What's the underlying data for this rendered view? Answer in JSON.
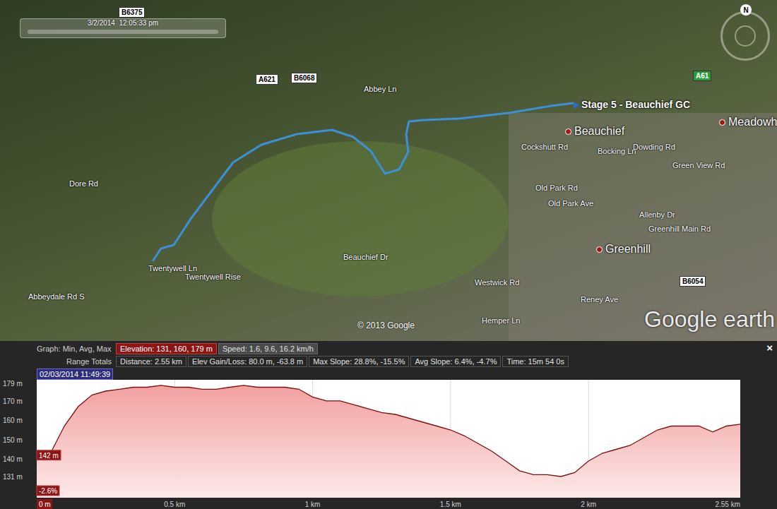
{
  "map": {
    "timestamp": "3/2/2014  12:05:33 pm",
    "compass": "N",
    "copyright": "© 2013 Google",
    "logo": "Google earth",
    "labels": [
      {
        "text": "B6375",
        "kind": "shield",
        "color": "#ffffff"
      },
      {
        "text": "A621",
        "kind": "shield",
        "color": "#ffffff"
      },
      {
        "text": "B6068",
        "kind": "shield",
        "color": "#ffffff"
      },
      {
        "text": "A61",
        "kind": "shield",
        "color": "#2e9b3a"
      },
      {
        "text": "B6054",
        "kind": "shield",
        "color": "#ffffff"
      },
      {
        "text": "Abbey Ln",
        "kind": "road"
      },
      {
        "text": "Dore Rd",
        "kind": "road"
      },
      {
        "text": "Abbeydale Rd S",
        "kind": "road"
      },
      {
        "text": "Twentywell Ln",
        "kind": "road"
      },
      {
        "text": "Twentywell Rise",
        "kind": "road"
      },
      {
        "text": "Beauchief Dr",
        "kind": "road"
      },
      {
        "text": "Cockshutt Rd",
        "kind": "road"
      },
      {
        "text": "Old Park Rd",
        "kind": "road"
      },
      {
        "text": "Old Park Ave",
        "kind": "road"
      },
      {
        "text": "Bocking Ln",
        "kind": "road"
      },
      {
        "text": "Dowding Rd",
        "kind": "road"
      },
      {
        "text": "Green View Rd",
        "kind": "road"
      },
      {
        "text": "Allenby Dr",
        "kind": "road"
      },
      {
        "text": "Greenhill Main Rd",
        "kind": "road"
      },
      {
        "text": "Westwick Rd",
        "kind": "road"
      },
      {
        "text": "Hemper Ln",
        "kind": "road"
      },
      {
        "text": "Reney Ave",
        "kind": "road"
      },
      {
        "text": "Beauchief",
        "kind": "place"
      },
      {
        "text": "Greenhill",
        "kind": "place"
      },
      {
        "text": "Meadowh",
        "kind": "place"
      },
      {
        "text": "Stage 5 - Beauchief GC",
        "kind": "track"
      }
    ]
  },
  "graph": {
    "title": "Graph: Min, Avg, Max",
    "close": "×",
    "stats": [
      {
        "text": "Elevation: 131, 160, 179 m",
        "selected": true
      },
      {
        "text": "Speed: 1.6, 9.6, 16.2 km/h",
        "selected": false
      }
    ],
    "totals_label": "Range Totals",
    "totals": [
      "Distance: 2.55 km",
      "Elev Gain/Loss: 80.0 m, -63.8 m",
      "Max Slope: 28.8%, -15.5%",
      "Avg Slope: 6.4%, -4.7%",
      "Time: 15m 54 0s"
    ],
    "date": "02/03/2014 11:49:39",
    "y_ticks": [
      {
        "text": "179 m",
        "value": 179
      },
      {
        "text": "170 m",
        "value": 170
      },
      {
        "text": "160 m",
        "value": 160
      },
      {
        "text": "150 m",
        "value": 150
      },
      {
        "text": "140 m",
        "value": 140
      },
      {
        "text": "131 m",
        "value": 131
      }
    ],
    "x_ticks": [
      {
        "text": "0 m",
        "km": 0
      },
      {
        "text": "0.5 km",
        "km": 0.5
      },
      {
        "text": "1 km",
        "km": 1
      },
      {
        "text": "1.5 km",
        "km": 1.5
      },
      {
        "text": "2 km",
        "km": 2
      },
      {
        "text": "2.55 km",
        "km": 2.55
      }
    ],
    "cursor_elevation": "142 m",
    "cursor_elevation_value": 142,
    "cursor_slope": "-2.6%",
    "distance_km": 2.55,
    "elevation": [
      142,
      143,
      157,
      167,
      173,
      175,
      176,
      177,
      177,
      178,
      177,
      177,
      176,
      176,
      177,
      178,
      177,
      177,
      177,
      176,
      172,
      170,
      170,
      168,
      166,
      164,
      163,
      161,
      159,
      157,
      155,
      152,
      148,
      144,
      139,
      134,
      132,
      132,
      131,
      133,
      139,
      143,
      145,
      147,
      151,
      155,
      157,
      157,
      157,
      154,
      157,
      158
    ]
  }
}
